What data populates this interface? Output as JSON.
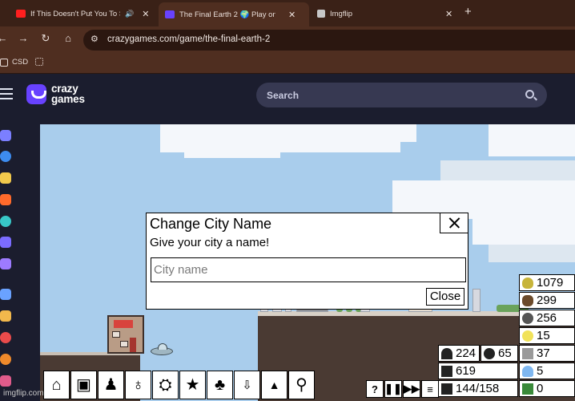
{
  "browser": {
    "tabs": [
      {
        "title": "If This Doesn't Put You To S",
        "icon": "youtube-icon",
        "color": "#ff1f1f",
        "muted_icon": "speaker-icon"
      },
      {
        "title": "The Final Earth 2 🌍 Play on C",
        "icon": "crazygames-tab-icon",
        "color": "#6842ff",
        "active": true
      },
      {
        "title": "Imgflip",
        "icon": "imgflip-icon",
        "color": "#c7c7c7"
      }
    ],
    "url": "crazygames.com/game/the-final-earth-2",
    "bookmarks": [
      {
        "label": "CSD"
      },
      {
        "label": ""
      }
    ]
  },
  "site": {
    "logo_line1": "crazy",
    "logo_line2": "games",
    "search_placeholder": "Search"
  },
  "dialog": {
    "title": "Change City Name",
    "subtitle": "Give your city a name!",
    "input_placeholder": "City name",
    "input_value": "",
    "close_label": "Close"
  },
  "resources": {
    "food": "1079",
    "wood": "299",
    "stone": "256",
    "knowledge": "15",
    "machine_parts": "37",
    "water": "5",
    "mutations": "0",
    "population": "224",
    "happiness": "65",
    "housing": "619",
    "jobs": "144/158"
  },
  "watermark": "imgflip.com"
}
